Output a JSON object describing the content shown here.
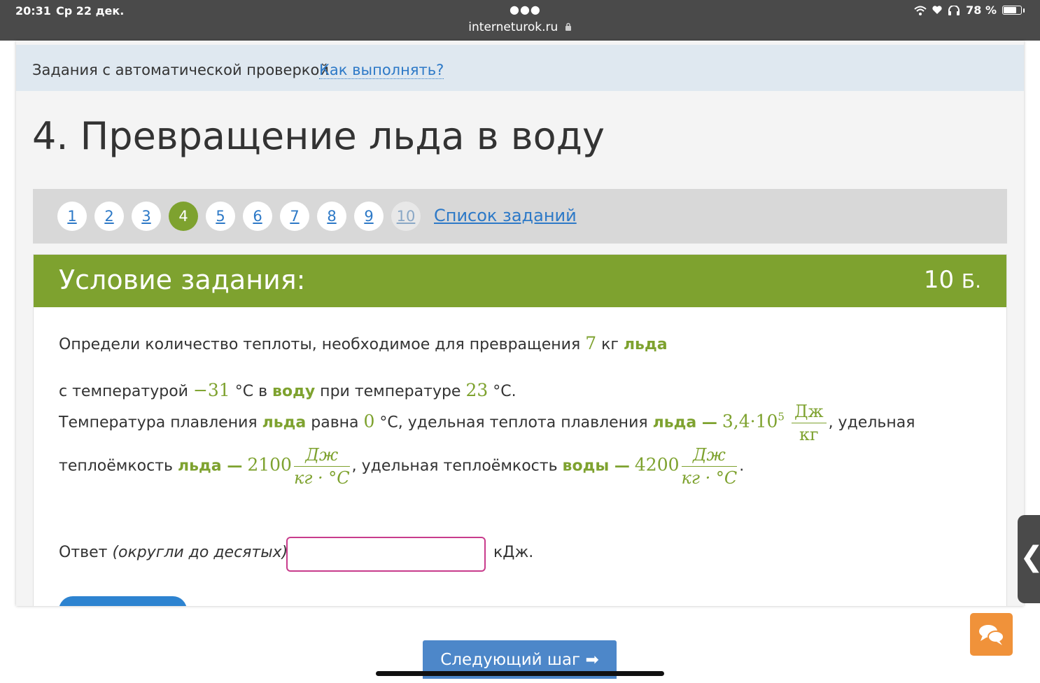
{
  "status_bar": {
    "time": "20:31",
    "date": "Ср 22 дек.",
    "url": "interneturok.ru",
    "battery": "78 %",
    "battery_level": 0.78
  },
  "top_bar": {
    "text": "Задания с автоматической проверкой",
    "link": "Как выполнять?"
  },
  "page_title": "4. Превращение льда в воду",
  "nav": {
    "items": [
      "1",
      "2",
      "3",
      "4",
      "5",
      "6",
      "7",
      "8",
      "9",
      "10"
    ],
    "active": "4",
    "task_list": "Список заданий"
  },
  "task": {
    "title": "Условие задания:",
    "points": "10",
    "points_unit": "Б.",
    "line1": {
      "p1": "Определи количество теплоты, необходимое для превращения ",
      "mass": "7",
      "p2": " кг ",
      "ice": "льда"
    },
    "line2": {
      "p1": "с температурой ",
      "t_start": "−31",
      "p2": " °C в ",
      "water": "воду",
      "p3": " при температуре ",
      "t_end": "23",
      "p4": " °C."
    },
    "line3": {
      "p1": "Температура плавления ",
      "ice": "льда",
      "p2": " равна ",
      "t_melt": "0",
      "p3": " °C, удельная теплота плавления ",
      "ice2": "льда —",
      "lambda_mantissa": "3,4·10",
      "lambda_exp": "5",
      "unit_num": "Дж",
      "unit_den": "кг",
      "p4": ", удельная"
    },
    "line4": {
      "p1": "теплоёмкость ",
      "ice": "льда —",
      "c_ice": "2100",
      "unit_num": "Дж",
      "unit_den": "кг · °C",
      "p2": ", удельная теплоёмкость ",
      "water": "воды —",
      "c_water": "4200",
      "p3": "."
    },
    "answer": {
      "label": "Ответ ",
      "hint": "(округли до десятых)",
      "colon": ":",
      "value": "",
      "unit": "кДж."
    }
  },
  "next_button": "Следующий шаг ➡",
  "side_tab_icon": "chevron-left-icon",
  "chat_icon": "chat-bubbles-icon"
}
